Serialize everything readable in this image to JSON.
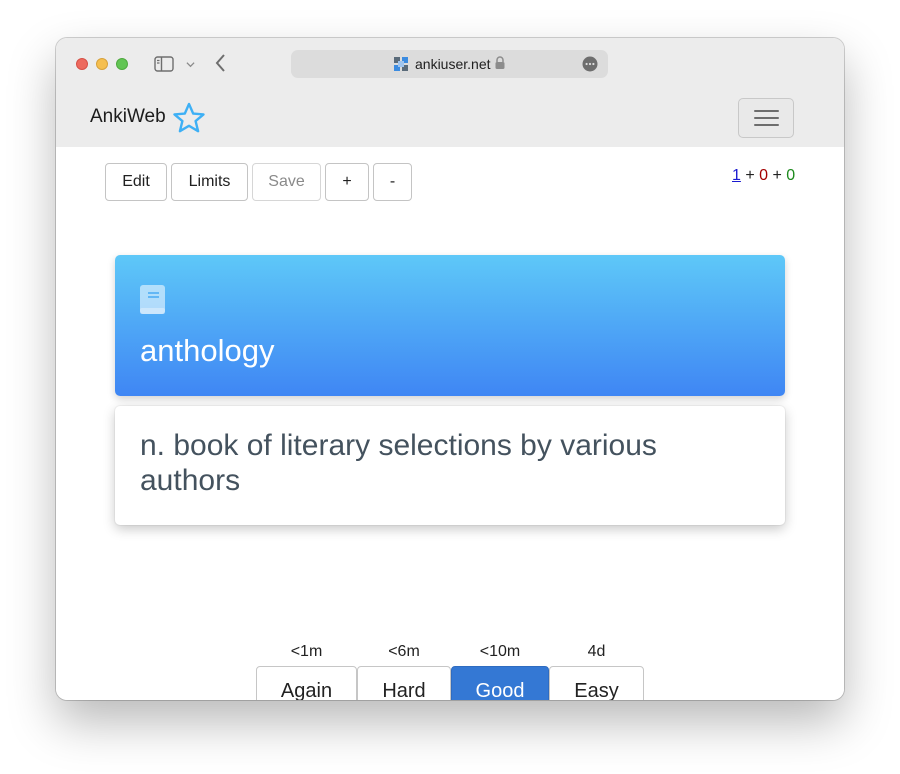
{
  "browser": {
    "url": "ankiuser.net"
  },
  "navbar": {
    "brand": "AnkiWeb"
  },
  "toolbar": {
    "edit": "Edit",
    "limits": "Limits",
    "save": "Save",
    "plus": "+",
    "minus": "-"
  },
  "counts": {
    "new": "1",
    "sep1": " + ",
    "learning": "0",
    "sep2": " + ",
    "review": "0"
  },
  "card": {
    "front": "anthology",
    "back": "n. book of literary selections by various authors"
  },
  "answer_buttons": [
    {
      "time": "<1m",
      "label": "Again"
    },
    {
      "time": "<6m",
      "label": "Hard"
    },
    {
      "time": "<10m",
      "label": "Good"
    },
    {
      "time": "4d",
      "label": "Easy"
    }
  ],
  "colors": {
    "card_gradient_top": "#5ec8f8",
    "card_gradient_bottom": "#3f86f4",
    "good_button": "#3478d4",
    "new_count": "#1a1ad0",
    "learning_count": "#a30000",
    "review_count": "#1c8a1c"
  },
  "icons": {
    "site": "anki-site-icon",
    "lock": "lock-icon",
    "brand_star": "star-icon",
    "card": "book-icon"
  }
}
